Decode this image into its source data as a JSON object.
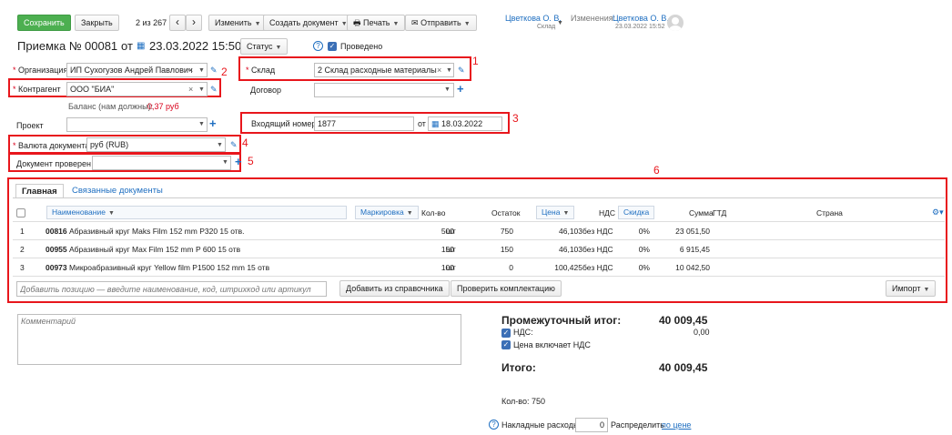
{
  "toolbar": {
    "save": "Сохранить",
    "close": "Закрыть",
    "counter": "2 из 267",
    "prev": "‹",
    "next": "›",
    "change": "Изменить",
    "create_doc": "Создать документ",
    "print": "Печать",
    "send": "Отправить"
  },
  "user": {
    "name": "Цветкова О. В.",
    "role": "Склад"
  },
  "changes": {
    "label": "Изменения:",
    "name": "Цветкова О. В.",
    "datetime": "23.03.2022 15:52"
  },
  "doc": {
    "title": "Приемка №",
    "number": "00081",
    "from": "от",
    "date": "23.03.2022 15:50",
    "status": "Статус",
    "help": "?",
    "posted": "Проведено"
  },
  "fields": {
    "org_label": "Организация",
    "org_value": "ИП Сухогузов Андрей Павлович",
    "contractor_label": "Контрагент",
    "contractor_value": "ООО \"БИА\"",
    "balance_label": "Баланс (нам должны):",
    "balance_value": "0,37 руб",
    "warehouse_label": "Склад",
    "warehouse_value": "2 Склад расходные материалы",
    "contract_label": "Договор",
    "contract_value": "",
    "project_label": "Проект",
    "project_value": "",
    "incoming_label": "Входящий номер",
    "incoming_value": "1877",
    "incoming_from": "от",
    "incoming_date": "18.03.2022",
    "currency_label": "Валюта документа",
    "currency_value": "руб (RUB)",
    "checked_label": "Документ проверен",
    "checked_value": ""
  },
  "annotations": [
    "1",
    "2",
    "3",
    "4",
    "5",
    "6"
  ],
  "tabs": [
    "Главная",
    "Связанные документы"
  ],
  "table": {
    "headers": {
      "name": "Наименование",
      "marking": "Маркировка",
      "qty": "Кол-во",
      "stock": "Остаток",
      "price": "Цена",
      "vat": "НДС",
      "discount": "Скидка",
      "sum": "Сумма",
      "gtd": "ГТД",
      "country": "Страна"
    },
    "rows": [
      {
        "n": "1",
        "code": "00816",
        "name": "Абразивный круг Maks Film 152 mm P320 15 отв.",
        "qty": "500",
        "unit": "шт",
        "stock": "750",
        "price": "46,103",
        "vat": "без НДС",
        "discount": "0%",
        "sum": "23 051,50"
      },
      {
        "n": "2",
        "code": "00955",
        "name": "Абразивный круг Max Film 152 mm P 600 15 отв",
        "qty": "150",
        "unit": "шт",
        "stock": "150",
        "price": "46,103",
        "vat": "без НДС",
        "discount": "0%",
        "sum": "6 915,45"
      },
      {
        "n": "3",
        "code": "00973",
        "name": "Микроабразивный круг Yellow film P1500 152 mm 15 отв",
        "qty": "100",
        "unit": "шт",
        "stock": "0",
        "price": "100,425",
        "vat": "без НДС",
        "discount": "0%",
        "sum": "10 042,50"
      }
    ],
    "add_placeholder": "Добавить позицию — введите наименование, код, штрихкод или артикул",
    "add_from_catalog": "Добавить из справочника",
    "check_kit": "Проверить комплектацию",
    "import": "Импорт"
  },
  "comment_placeholder": "Комментарий",
  "totals": {
    "subtotal_label": "Промежуточный итог:",
    "subtotal_value": "40 009,45",
    "vat_label": "НДС:",
    "vat_value": "0,00",
    "price_incl_vat": "Цена включает НДС",
    "total_label": "Итого:",
    "total_value": "40 009,45",
    "qty_label": "Кол-во: 750",
    "overhead_label": "Накладные расходы",
    "overhead_value": "0",
    "distribute_label": "Распределить",
    "distribute_link": "по цене"
  }
}
